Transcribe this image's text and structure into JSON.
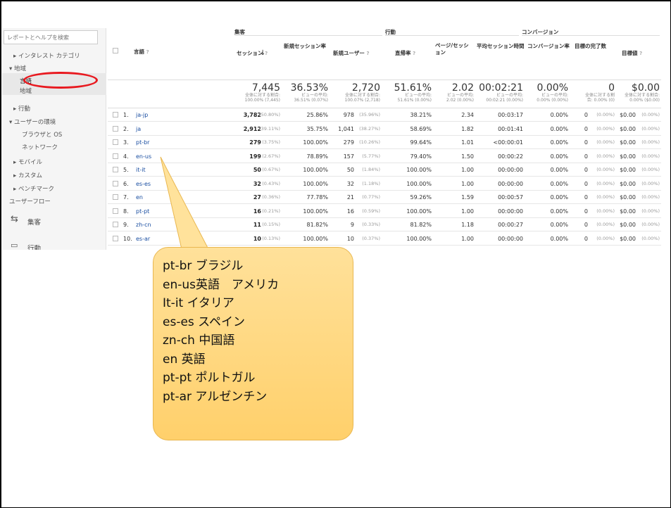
{
  "sidebar": {
    "search_placeholder": "レポートとヘルプを検索",
    "items": [
      {
        "label": "▸ インタレスト カテゴリ"
      },
      {
        "label": "▾ 地域"
      },
      {
        "label": "言語"
      },
      {
        "label": "地域"
      },
      {
        "label": "▸ 行動"
      },
      {
        "label": "▾ ユーザーの環境"
      },
      {
        "label": "ブラウザと OS"
      },
      {
        "label": "ネットワーク"
      },
      {
        "label": "▸ モバイル"
      },
      {
        "label": "▸ カスタム"
      },
      {
        "label": "▸ ベンチマーク"
      },
      {
        "label": "ユーザーフロー"
      }
    ],
    "acquisition_label": "集客",
    "behavior_label": "行動"
  },
  "table": {
    "groups": {
      "acquisition": "集客",
      "behavior": "行動",
      "conversion": "コンバージョン"
    },
    "headers": {
      "language": "言語",
      "sessions": "セッション",
      "new_session_rate": "新規セッション率",
      "new_users": "新規ユーザー",
      "bounce_rate": "直帰率",
      "pages_per_session": "ページ/セッション",
      "avg_session_duration": "平均セッション時間",
      "conversion_rate": "コンバージョン率",
      "goal_completions": "目標の完了数",
      "goal_value": "目標値"
    },
    "totals": {
      "sessions": "7,445",
      "sessions_sub1": "全体に対する割合:",
      "sessions_sub2": "100.00% (7,445)",
      "new_session_rate": "36.53%",
      "new_session_rate_sub1": "ビューの平均:",
      "new_session_rate_sub2": "36.51% (0.07%)",
      "new_users": "2,720",
      "new_users_sub1": "全体に対する割合:",
      "new_users_sub2": "100.07% (2,718)",
      "bounce_rate": "51.61%",
      "bounce_rate_sub1": "ビューの平均:",
      "bounce_rate_sub2": "51.61% (0.00%)",
      "pages_per_session": "2.02",
      "pages_per_session_sub1": "ビューの平均:",
      "pages_per_session_sub2": "2.02 (0.00%)",
      "avg_session_duration": "00:02:21",
      "avg_session_duration_sub1": "ビューの平均:",
      "avg_session_duration_sub2": "00:02:21 (0.00%)",
      "conversion_rate": "0.00%",
      "conversion_rate_sub1": "ビューの平均:",
      "conversion_rate_sub2": "0.00% (0.00%)",
      "goal_completions": "0",
      "goal_completions_sub1": "全体に対する割",
      "goal_completions_sub2": "合: 0.00% (0)",
      "goal_value": "$0.00",
      "goal_value_sub1": "全体に対する割合:",
      "goal_value_sub2": "0.00% ($0.00)"
    },
    "rows": [
      {
        "num": "1.",
        "lang": "ja-jp",
        "sessions": "3,782",
        "sessions_pct": "(50.80%)",
        "nsr": "25.86%",
        "nu": "978",
        "nu_pct": "(35.96%)",
        "br": "38.21%",
        "pps": "2.34",
        "asd": "00:03:17",
        "cr": "0.00%",
        "gc": "0",
        "gc_pct": "(0.00%)",
        "gv": "$0.00",
        "gv_pct": "(0.00%)"
      },
      {
        "num": "2.",
        "lang": "ja",
        "sessions": "2,912",
        "sessions_pct": "(39.11%)",
        "nsr": "35.75%",
        "nu": "1,041",
        "nu_pct": "(38.27%)",
        "br": "58.69%",
        "pps": "1.82",
        "asd": "00:01:41",
        "cr": "0.00%",
        "gc": "0",
        "gc_pct": "(0.00%)",
        "gv": "$0.00",
        "gv_pct": "(0.00%)"
      },
      {
        "num": "3.",
        "lang": "pt-br",
        "sessions": "279",
        "sessions_pct": "(3.75%)",
        "nsr": "100.00%",
        "nu": "279",
        "nu_pct": "(10.26%)",
        "br": "99.64%",
        "pps": "1.01",
        "asd": "<00:00:01",
        "cr": "0.00%",
        "gc": "0",
        "gc_pct": "(0.00%)",
        "gv": "$0.00",
        "gv_pct": "(0.00%)"
      },
      {
        "num": "4.",
        "lang": "en-us",
        "sessions": "199",
        "sessions_pct": "(2.67%)",
        "nsr": "78.89%",
        "nu": "157",
        "nu_pct": "(5.77%)",
        "br": "79.40%",
        "pps": "1.50",
        "asd": "00:00:22",
        "cr": "0.00%",
        "gc": "0",
        "gc_pct": "(0.00%)",
        "gv": "$0.00",
        "gv_pct": "(0.00%)"
      },
      {
        "num": "5.",
        "lang": "it-it",
        "sessions": "50",
        "sessions_pct": "(0.67%)",
        "nsr": "100.00%",
        "nu": "50",
        "nu_pct": "(1.84%)",
        "br": "100.00%",
        "pps": "1.00",
        "asd": "00:00:00",
        "cr": "0.00%",
        "gc": "0",
        "gc_pct": "(0.00%)",
        "gv": "$0.00",
        "gv_pct": "(0.00%)"
      },
      {
        "num": "6.",
        "lang": "es-es",
        "sessions": "32",
        "sessions_pct": "(0.43%)",
        "nsr": "100.00%",
        "nu": "32",
        "nu_pct": "(1.18%)",
        "br": "100.00%",
        "pps": "1.00",
        "asd": "00:00:00",
        "cr": "0.00%",
        "gc": "0",
        "gc_pct": "(0.00%)",
        "gv": "$0.00",
        "gv_pct": "(0.00%)"
      },
      {
        "num": "7.",
        "lang": "en",
        "sessions": "27",
        "sessions_pct": "(0.36%)",
        "nsr": "77.78%",
        "nu": "21",
        "nu_pct": "(0.77%)",
        "br": "59.26%",
        "pps": "1.59",
        "asd": "00:00:57",
        "cr": "0.00%",
        "gc": "0",
        "gc_pct": "(0.00%)",
        "gv": "$0.00",
        "gv_pct": "(0.00%)"
      },
      {
        "num": "8.",
        "lang": "pt-pt",
        "sessions": "16",
        "sessions_pct": "(0.21%)",
        "nsr": "100.00%",
        "nu": "16",
        "nu_pct": "(0.59%)",
        "br": "100.00%",
        "pps": "1.00",
        "asd": "00:00:00",
        "cr": "0.00%",
        "gc": "0",
        "gc_pct": "(0.00%)",
        "gv": "$0.00",
        "gv_pct": "(0.00%)"
      },
      {
        "num": "9.",
        "lang": "zh-cn",
        "sessions": "11",
        "sessions_pct": "(0.15%)",
        "nsr": "81.82%",
        "nu": "9",
        "nu_pct": "(0.33%)",
        "br": "81.82%",
        "pps": "1.18",
        "asd": "00:00:27",
        "cr": "0.00%",
        "gc": "0",
        "gc_pct": "(0.00%)",
        "gv": "$0.00",
        "gv_pct": "(0.00%)"
      },
      {
        "num": "10.",
        "lang": "es-ar",
        "sessions": "10",
        "sessions_pct": "(0.13%)",
        "nsr": "100.00%",
        "nu": "10",
        "nu_pct": "(0.37%)",
        "br": "100.00%",
        "pps": "1.00",
        "asd": "00:00:00",
        "cr": "0.00%",
        "gc": "0",
        "gc_pct": "(0.00%)",
        "gv": "$0.00",
        "gv_pct": "(0.00%)"
      }
    ]
  },
  "callout": {
    "lines": [
      "pt-br ブラジル",
      "en-us英語　アメリカ",
      "It-it イタリア",
      "es-es スペイン",
      "zn-ch 中国語",
      "en 英語",
      "pt-pt ポルトガル",
      "pt-ar アルゼンチン"
    ]
  },
  "colors": {
    "callout_fill": "#ffd774",
    "highlight_ellipse": "#e8191f",
    "link": "#1a4ea1"
  }
}
